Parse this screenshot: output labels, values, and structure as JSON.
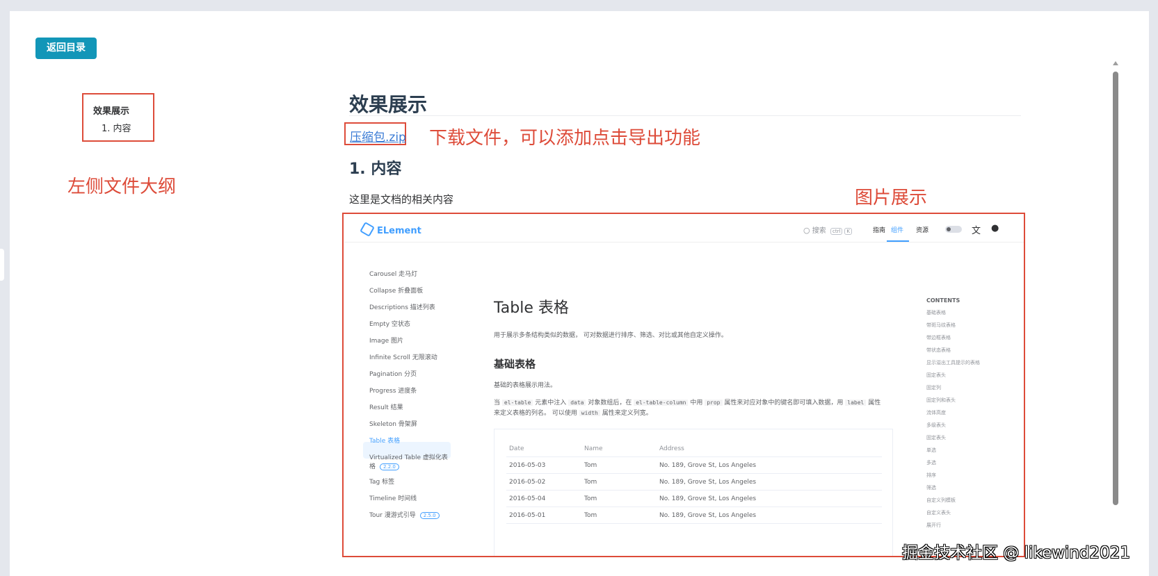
{
  "page": {
    "back_button": "返回目录",
    "outline": {
      "title": "效果展示",
      "items": [
        "1. 内容"
      ]
    },
    "doc": {
      "title": "效果展示",
      "download_link": "压缩包.zip",
      "section_title": "1. 内容",
      "paragraph": "这里是文档的相关内容"
    },
    "annotations": {
      "outline_label": "左侧文件大纲",
      "download_label": "下载文件，可以添加点击导出功能",
      "image_label": "图片展示"
    },
    "watermark": "掘金技术社区 @ likewind2021"
  },
  "embedded": {
    "logo": "ELement",
    "search_label": "搜索",
    "kbd": [
      "ctrl",
      "K"
    ],
    "nav": [
      "指南",
      "组件",
      "资源"
    ],
    "nav_active": "组件",
    "sidebar_items": [
      "Carousel 走马灯",
      "Collapse 折叠面板",
      "Descriptions 描述列表",
      "Empty 空状态",
      "Image 图片",
      "Infinite Scroll 无限滚动",
      "Pagination 分页",
      "Progress 进度条",
      "Result 结果",
      "Skeleton 骨架屏",
      "Table 表格",
      "Virtualized Table 虚拟化表格",
      "Tag 标签",
      "Timeline 时间线",
      "Tour 漫游式引导"
    ],
    "sidebar_badges": {
      "virtualized": "2.2.0",
      "tour": "2.5.0"
    },
    "main_title": "Table 表格",
    "main_desc": "用于展示多条结构类似的数据， 可对数据进行排序、筛选、对比或其他自定义操作。",
    "section_title": "基础表格",
    "section_desc": "基础的表格展示用法。",
    "detail_line1": {
      "t1": "当",
      "c1": "el-table",
      "t2": "元素中注入",
      "c2": "data",
      "t3": "对象数组后，在",
      "c3": "el-table-column",
      "t4": "中用",
      "c4": "prop",
      "t5": "属性来对应对象中的键名即可填入数据，用",
      "c5": "label",
      "t6": "属性"
    },
    "detail_line2": {
      "t1": "来定义表格的列名。 可以使用",
      "c1": "width",
      "t2": "属性来定义列宽。"
    },
    "table": {
      "headers": [
        "Date",
        "Name",
        "Address"
      ],
      "rows": [
        [
          "2016-05-03",
          "Tom",
          "No. 189, Grove St, Los Angeles"
        ],
        [
          "2016-05-02",
          "Tom",
          "No. 189, Grove St, Los Angeles"
        ],
        [
          "2016-05-04",
          "Tom",
          "No. 189, Grove St, Los Angeles"
        ],
        [
          "2016-05-01",
          "Tom",
          "No. 189, Grove St, Los Angeles"
        ]
      ]
    },
    "toc_title": "CONTENTS",
    "toc_items": [
      "基础表格",
      "带斑马纹表格",
      "带边框表格",
      "带状态表格",
      "显示溢出工具提示的表格",
      "固定表头",
      "固定列",
      "固定列和表头",
      "流体高度",
      "多级表头",
      "固定表头",
      "单选",
      "多选",
      "排序",
      "筛选",
      "自定义列模板",
      "自定义表头",
      "展开行"
    ]
  },
  "colors": {
    "annotation": "#dd4b39",
    "primary_button": "#1296b8",
    "element_blue": "#409eff",
    "link": "#3a7bd5"
  }
}
